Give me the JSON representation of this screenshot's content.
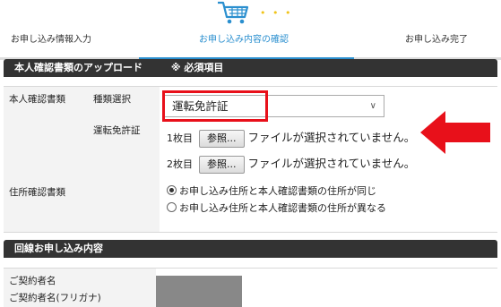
{
  "steps": {
    "items": [
      {
        "label": "お申し込み情報入力"
      },
      {
        "label": "お申し込み内容の確認"
      },
      {
        "label": "お申し込み完了"
      }
    ],
    "active_index": 1
  },
  "upload_section": {
    "title": "本人確認書類のアップロード",
    "required_note": "※ 必須項目",
    "identity_doc_label": "本人確認書類",
    "doc_type_label": "種類選択",
    "doc_type_value": "運転免許証",
    "doc_name_label": "運転免許証",
    "files": [
      {
        "index_label": "1枚目",
        "button_label": "参照...",
        "status": "ファイルが選択されていません。"
      },
      {
        "index_label": "2枚目",
        "button_label": "参照...",
        "status": "ファイルが選択されていません。"
      }
    ],
    "address_doc_label": "住所確認書類",
    "address_options": [
      {
        "label": "お申し込み住所と本人確認書類の住所が同じ",
        "selected": true
      },
      {
        "label": "お申し込み住所と本人確認書類の住所が異なる",
        "selected": false
      }
    ]
  },
  "contract_section": {
    "title": "回線お申し込み内容",
    "contractor_name_label": "ご契約者名",
    "contractor_kana_label": "ご契約者名(フリガナ)"
  },
  "colors": {
    "accent": "#2a8fcf",
    "highlight": "#e8101a",
    "header_bg": "#333333"
  }
}
